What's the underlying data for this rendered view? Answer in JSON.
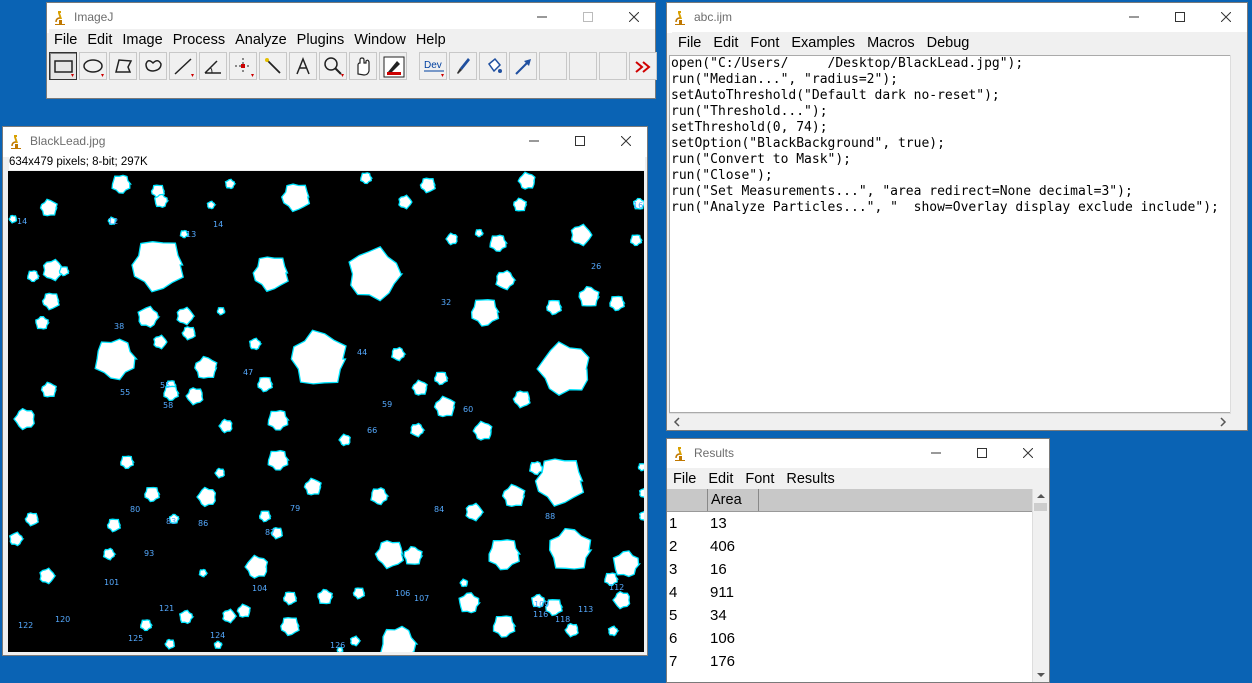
{
  "imagej": {
    "title": "ImageJ",
    "menus": [
      "File",
      "Edit",
      "Image",
      "Process",
      "Analyze",
      "Plugins",
      "Window",
      "Help"
    ],
    "tools": [
      "rectangle-tool",
      "oval-tool",
      "polygon-tool",
      "freehand-tool",
      "line-tool",
      "angle-tool",
      "point-tool",
      "wand-tool",
      "text-tool",
      "magnifier-tool",
      "scroll-tool",
      "color-picker-tool",
      "dev-tool",
      "brush-tool",
      "flood-fill-tool",
      "arrow-tool",
      "",
      "",
      "",
      "more-tools"
    ],
    "dev_label": "Dev"
  },
  "image_window": {
    "title": "BlackLead.jpg",
    "info": "634x479 pixels; 8-bit; 297K",
    "particle_labels": [
      {
        "t": "14"
      },
      {
        "t": "12"
      },
      {
        "t": "13"
      },
      {
        "t": "14"
      },
      {
        "t": "16"
      },
      {
        "t": "26"
      },
      {
        "t": "32"
      },
      {
        "t": "38"
      },
      {
        "t": "44"
      },
      {
        "t": "47"
      },
      {
        "t": "55"
      },
      {
        "t": "55"
      },
      {
        "t": "58"
      },
      {
        "t": "59"
      },
      {
        "t": "66"
      },
      {
        "t": "60"
      },
      {
        "t": "80"
      },
      {
        "t": "83"
      },
      {
        "t": "86"
      },
      {
        "t": "87"
      },
      {
        "t": "79"
      },
      {
        "t": "84"
      },
      {
        "t": "88"
      },
      {
        "t": "93"
      },
      {
        "t": "101"
      },
      {
        "t": "104"
      },
      {
        "t": "106"
      },
      {
        "t": "107"
      },
      {
        "t": "109"
      },
      {
        "t": "112"
      },
      {
        "t": "113"
      },
      {
        "t": "116"
      },
      {
        "t": "118"
      },
      {
        "t": "122"
      },
      {
        "t": "120"
      },
      {
        "t": "121"
      },
      {
        "t": "125"
      },
      {
        "t": "124"
      },
      {
        "t": "126"
      }
    ]
  },
  "macro_window": {
    "title": "abc.ijm",
    "menus": [
      "File",
      "Edit",
      "Font",
      "Examples",
      "Macros",
      "Debug"
    ],
    "lines": [
      "open(\"C:/Users/     /Desktop/BlackLead.jpg\");",
      "run(\"Median...\", \"radius=2\");",
      "setAutoThreshold(\"Default dark no-reset\");",
      "run(\"Threshold...\");",
      "setThreshold(0, 74);",
      "setOption(\"BlackBackground\", true);",
      "run(\"Convert to Mask\");",
      "run(\"Close\");",
      "run(\"Set Measurements...\", \"area redirect=None decimal=3\");",
      "run(\"Analyze Particles...\", \"  show=Overlay display exclude include\");"
    ]
  },
  "results_window": {
    "title": "Results",
    "menus": [
      "File",
      "Edit",
      "Font",
      "Results"
    ],
    "columns": [
      "",
      "Area"
    ],
    "rows": [
      {
        "n": "1",
        "area": "13"
      },
      {
        "n": "2",
        "area": "406"
      },
      {
        "n": "3",
        "area": "16"
      },
      {
        "n": "4",
        "area": "911"
      },
      {
        "n": "5",
        "area": "34"
      },
      {
        "n": "6",
        "area": "106"
      },
      {
        "n": "7",
        "area": "176"
      }
    ]
  },
  "colors": {
    "desktop": "#0a63b4",
    "particle_outline": "#00e5ff",
    "particle_fill": "#ffffff",
    "label": "#55aaff"
  }
}
